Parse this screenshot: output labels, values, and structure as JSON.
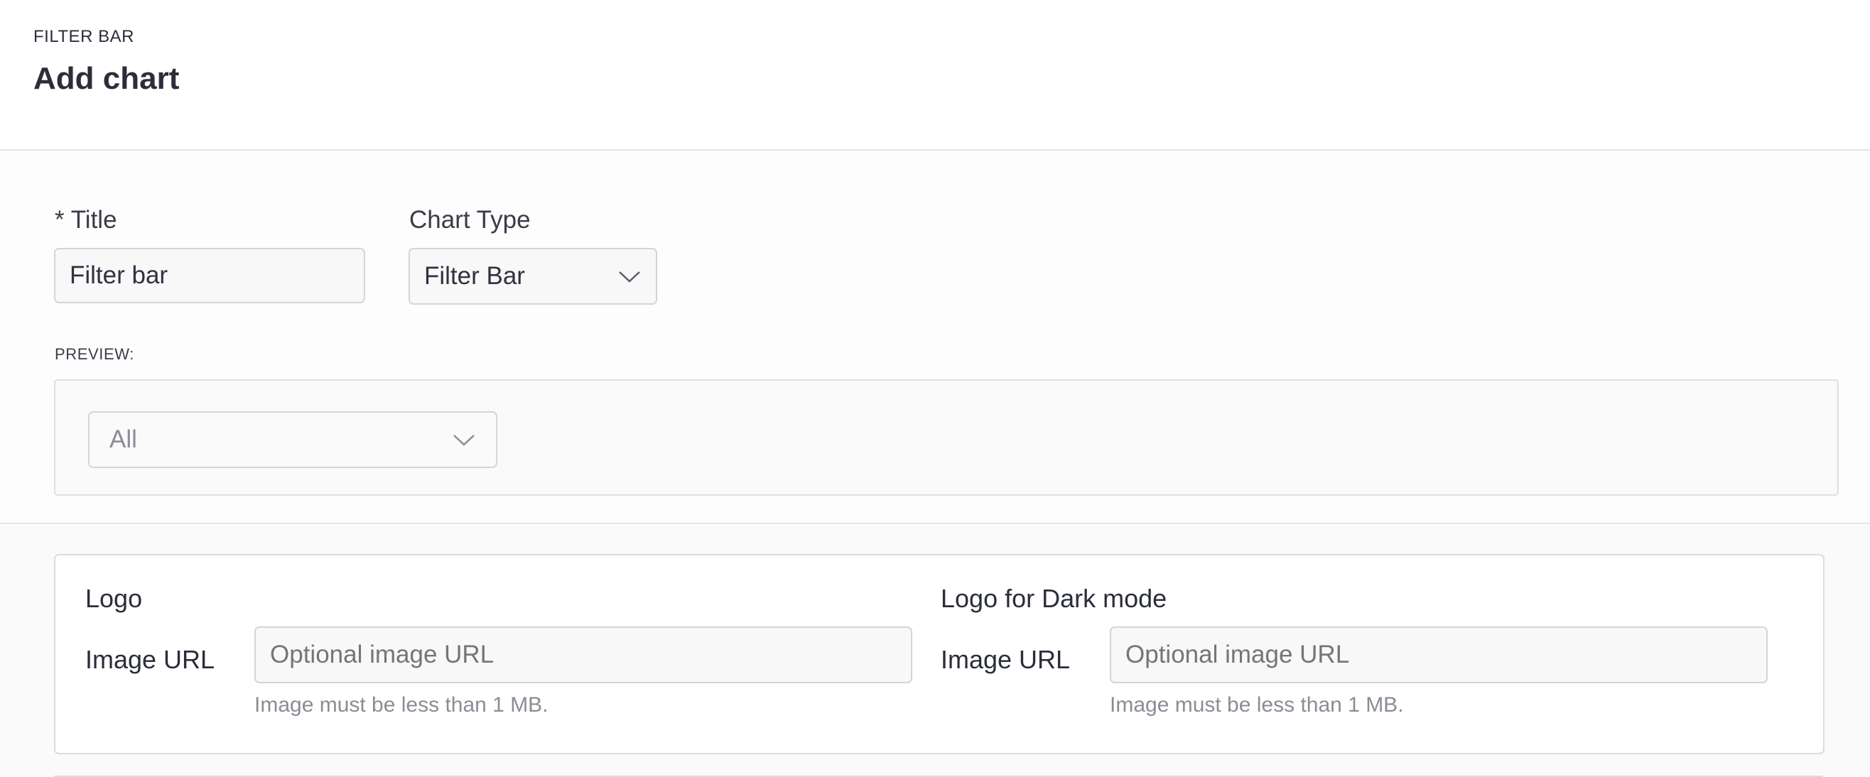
{
  "header": {
    "eyebrow": "FILTER BAR",
    "title": "Add chart"
  },
  "form": {
    "title_label": "* Title",
    "title_value": "Filter bar",
    "chart_type_label": "Chart Type",
    "chart_type_value": "Filter Bar",
    "preview_label": "PREVIEW:",
    "preview_select_value": "All"
  },
  "logo": {
    "light": {
      "heading": "Logo",
      "url_label": "Image URL",
      "placeholder": "Optional image URL",
      "help": "Image must be less than 1 MB."
    },
    "dark": {
      "heading": "Logo for Dark mode",
      "url_label": "Image URL",
      "placeholder": "Optional image URL",
      "help": "Image must be less than 1 MB."
    }
  },
  "icons": {
    "dropdown": "chevron-down-icon"
  },
  "colors": {
    "text": "#2b2e3a",
    "border": "#d3d5db",
    "muted": "#8a8d96",
    "placeholder": "#b0b2b9"
  }
}
